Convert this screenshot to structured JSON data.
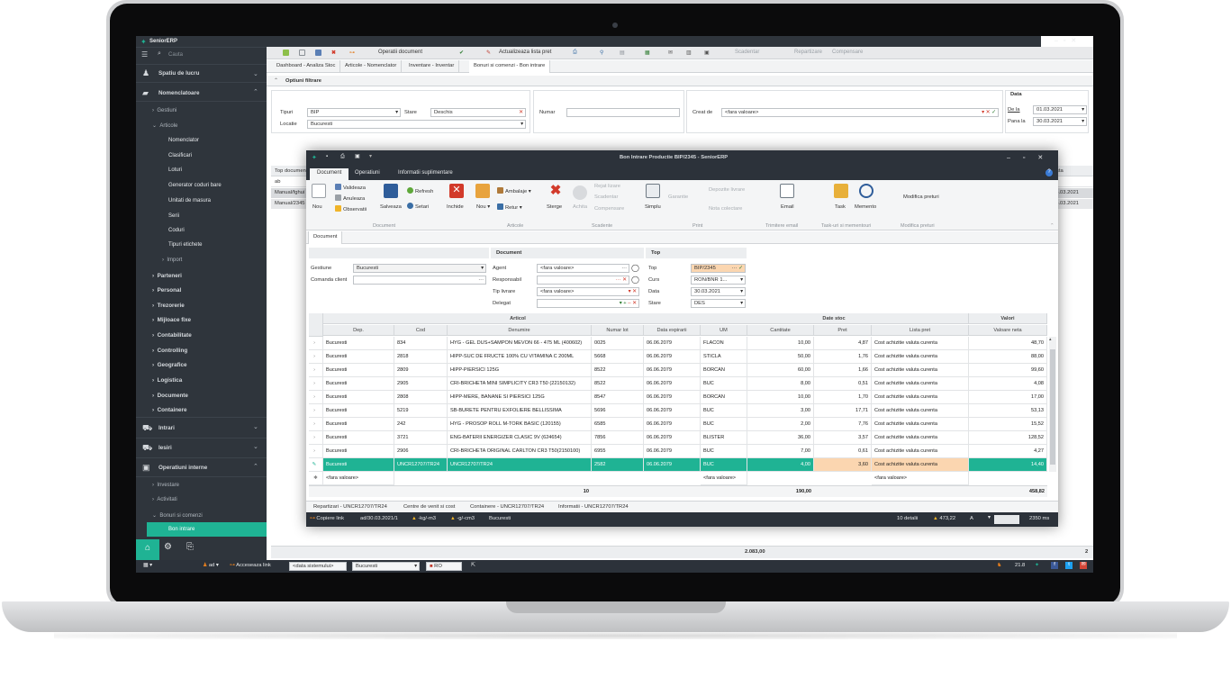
{
  "app": {
    "name": "SeniorERP",
    "search_placeholder": "Cauta"
  },
  "sidebar": {
    "sections": [
      {
        "label": "Spatiu de lucru"
      },
      {
        "label": "Nomenclatoare"
      },
      {
        "label": "Intrari"
      },
      {
        "label": "Iesiri"
      },
      {
        "label": "Operatiuni interne"
      }
    ],
    "nomenclatoare_children": [
      "Gestiuni",
      "Articole"
    ],
    "articole_children": [
      "Nomenclator",
      "Clasificari",
      "Loturi",
      "Generator coduri bare",
      "Unitati de masura",
      "Serii",
      "Coduri",
      "Tipuri etichete",
      "Import"
    ],
    "more_groups": [
      "Parteneri",
      "Personal",
      "Trezorerie",
      "Mijloace fixe",
      "Contabilitate",
      "Controlling",
      "Geografice",
      "Logistica",
      "Documente",
      "Containere"
    ],
    "operatiuni_children": [
      "Investare",
      "Activitati",
      "Bonuri si comenzi"
    ],
    "active_item": "Bon intrare"
  },
  "toolbar": {
    "operatii": "Operatii document",
    "actualizeaza": "Actualizeaza lista pret",
    "scadentar": "Scadentar",
    "repartizare": "Repartizare",
    "compensare": "Compensare"
  },
  "tabs": [
    "Dashboard - Analiza Stoc",
    "Articole - Nomenclator",
    "Inventare - Inventar",
    "Bonuri si comenzi - Bon intrare"
  ],
  "filters": {
    "title": "Optiuni filtrare",
    "tipuri_label": "Tipuri",
    "tipuri_value": "BIP",
    "stare_label": "Stare",
    "stare_value": "Deschis",
    "locatie_label": "Locatie",
    "locatie_value": "Bucuresti",
    "numar_label": "Numar",
    "creat_de_label": "Creat de",
    "creat_de_value": "<fara valoare>",
    "data_title": "Data",
    "de_la_label": "De la",
    "de_la_value": "01.03.2021",
    "pana_la_label": "Pana la",
    "pana_la_value": "30.03.2021"
  },
  "bg_list": {
    "col": "Top documen",
    "col2": "sta",
    "filter": "ab",
    "rows": [
      "Manual/fghui",
      "Manual/2345"
    ],
    "dates": [
      "15.03.2021",
      "15.03.2021"
    ],
    "total": "2.083,00",
    "count": "2"
  },
  "dialog": {
    "title": "Bon Intrare Productie BIP/2345 - SeniorERP",
    "tabs": [
      "Document",
      "Operatiuni",
      "Informatii suplimentare"
    ],
    "ribbon": {
      "nou": "Nou",
      "valideaza": "Valideaza",
      "anuleaza": "Anuleaza",
      "observatii": "Observatii",
      "salveaza": "Salveaza",
      "refresh": "Refresh",
      "setari": "Setari",
      "inchide": "Inchide",
      "nou2": "Nou",
      "ambalaje": "Ambalaje",
      "retur": "Retur",
      "sterge": "Sterge",
      "achita": "Achita",
      "rejat": "Rejat lizare",
      "scadentar": "Scadentar",
      "compensare": "Compensare",
      "simplu": "Simplu",
      "garantie": "Garantie",
      "depozite": "Depozite livrare",
      "nota": "Nota colectare",
      "email": "Email",
      "task": "Task",
      "memento": "Memento",
      "modifica": "Modifica preturi",
      "groups": [
        "Document",
        "Articole",
        "Scadente",
        "Print",
        "Trimitere email",
        "Task-uri si mementouri",
        "Modifica preturi"
      ]
    },
    "subtab": "Document",
    "form": {
      "gestiune_label": "Gestiune",
      "gestiune_value": "Bucuresti",
      "comanda_label": "Comanda client",
      "document_header": "Document",
      "agent_label": "Agent",
      "agent_value": "<fara valoare>",
      "responsabil_label": "Responsabil",
      "tip_livrare_label": "Tip livrare",
      "tip_livrare_value": "<fara valoare>",
      "delegat_label": "Delegat",
      "top_header": "Top",
      "top_label": "Top",
      "top_value": "BIP/2345",
      "curs_label": "Curs",
      "curs_value": "RON/BNR 1...",
      "data_label": "Data",
      "data_value": "30.03.2021",
      "stare_label": "Stare",
      "stare_value": "DES"
    },
    "grid": {
      "group_articol": "Articol",
      "group_date_stoc": "Date stoc",
      "group_valori": "Valori",
      "columns": [
        "Dep.",
        "Cod",
        "Denumire",
        "Numar lot",
        "Data expirarii",
        "UM",
        "Cantitate",
        "Pret",
        "Lista pret",
        "Valoare neta"
      ],
      "rows": [
        [
          "Bucuresti",
          "834",
          "HYG - GEL DUS+SAMPON MEVON 66 - 475 ML (400602)",
          "0025",
          "06.06.2079",
          "FLACON",
          "10,00",
          "4,87",
          "Cost achizitie valuta curenta",
          "48,70"
        ],
        [
          "Bucuresti",
          "2818",
          "HIPP-SUC DE FRUCTE 100% CU VITAMINA C 200ML",
          "5668",
          "06.06.2079",
          "STICLA",
          "50,00",
          "1,76",
          "Cost achizitie valuta curenta",
          "88,00"
        ],
        [
          "Bucuresti",
          "2809",
          "HIPP-PIERSICI 125G",
          "8522",
          "06.06.2079",
          "BORCAN",
          "60,00",
          "1,66",
          "Cost achizitie valuta curenta",
          "99,60"
        ],
        [
          "Bucuresti",
          "2905",
          "CRI-BRICHETA MINI SIMPLICITY CR3 T50 (22150132)",
          "8522",
          "06.06.2079",
          "BUC",
          "8,00",
          "0,51",
          "Cost achizitie valuta curenta",
          "4,08"
        ],
        [
          "Bucuresti",
          "2808",
          "HIPP-MERE, BANANE SI PIERSICI 125G",
          "8547",
          "06.06.2079",
          "BORCAN",
          "10,00",
          "1,70",
          "Cost achizitie valuta curenta",
          "17,00"
        ],
        [
          "Bucuresti",
          "5219",
          "SB-BURETE PENTRU EXFOLIERE BELLISSIMA",
          "5696",
          "06.06.2079",
          "BUC",
          "3,00",
          "17,71",
          "Cost achizitie valuta curenta",
          "53,13"
        ],
        [
          "Bucuresti",
          "242",
          "HYG - PROSOP ROLL M-TORK BASIC (120155)",
          "6585",
          "06.06.2079",
          "BUC",
          "2,00",
          "7,76",
          "Cost achizitie valuta curenta",
          "15,52"
        ],
        [
          "Bucuresti",
          "3721",
          "ENG-BATERII ENERGIZER CLASIC 9V (624654)",
          "7856",
          "06.06.2079",
          "BLISTER",
          "36,00",
          "3,57",
          "Cost achizitie valuta curenta",
          "128,52"
        ],
        [
          "Bucuresti",
          "2906",
          "CRI-BRICHETA ORIGINAL CARLTON CR3 T50(2150100)",
          "6955",
          "06.06.2079",
          "BUC",
          "7,00",
          "0,61",
          "Cost achizitie valuta curenta",
          "4,27"
        ],
        [
          "Bucuresti",
          "UNCR12707/TR24",
          "UNCR12707/TR24",
          "2582",
          "06.06.2079",
          "BUC",
          "4,00",
          "3,60",
          "Cost achizitie valuta curenta",
          "14,40"
        ]
      ],
      "new_row": {
        "dep": "<fara valoare>",
        "um": "<fara valoare>",
        "lista": "<fara valoare>"
      },
      "totals": {
        "count": "10",
        "cantitate": "190,00",
        "valoare": "458,82"
      }
    },
    "bottom_tabs": [
      "Repartizari - UNCR12707/TR24",
      "Centre de venit si cost",
      "Containere - UNCR12707/TR24",
      "Informatii - UNCR12707/TR24"
    ],
    "status": {
      "copiere": "Copiere link",
      "ad": "ad/30.03.2021/1",
      "kg": "-kg/-m3",
      "g": "-g/-cm3",
      "loc": "Bucuresti",
      "detalii": "10 detalii",
      "suma": "473,22",
      "a": "A",
      "ms": "2350 ms"
    }
  },
  "bottombar": {
    "user": "ad",
    "link": "Acceseaza link",
    "data": "<data sistemului>",
    "loc": "Bucuresti",
    "lang": "RO",
    "temp": "21.8"
  },
  "colors": {
    "accent": "#1fb394",
    "sidebar": "#2f353c",
    "dark": "#2c323a",
    "price_highlight": "#fbd6b0"
  }
}
